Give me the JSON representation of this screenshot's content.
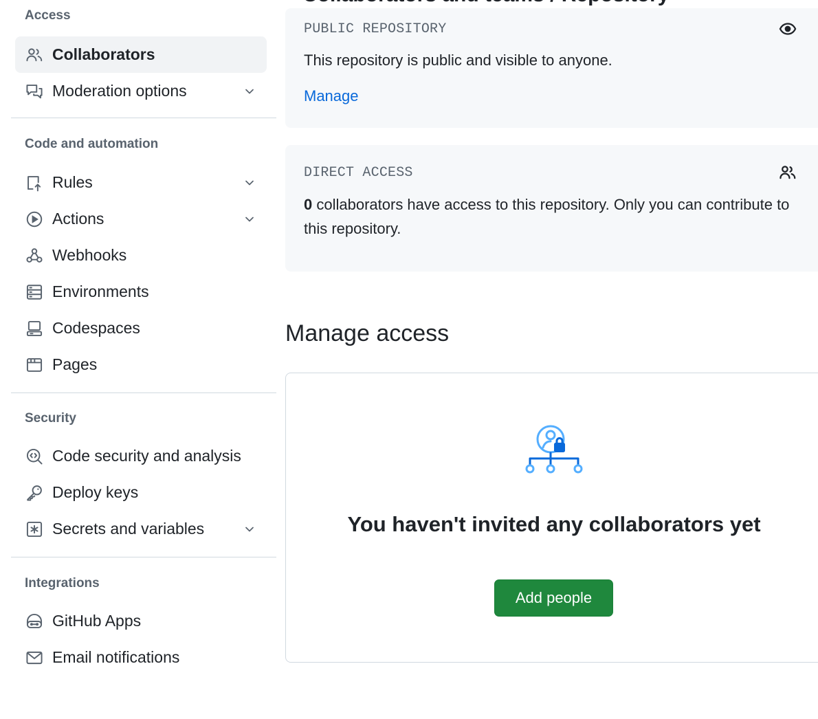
{
  "header": {
    "cut_title": "Collaborators and teams / Repository"
  },
  "sidebar": {
    "sections": [
      {
        "heading": "Access",
        "items": [
          {
            "label": "Collaborators",
            "icon": "people-icon",
            "active": true,
            "expandable": false
          },
          {
            "label": "Moderation options",
            "icon": "comment-discussion-icon",
            "active": false,
            "expandable": true
          }
        ]
      },
      {
        "heading": "Code and automation",
        "items": [
          {
            "label": "Rules",
            "icon": "repo-push-icon",
            "active": false,
            "expandable": true
          },
          {
            "label": "Actions",
            "icon": "play-icon",
            "active": false,
            "expandable": true
          },
          {
            "label": "Webhooks",
            "icon": "webhook-icon",
            "active": false,
            "expandable": false
          },
          {
            "label": "Environments",
            "icon": "server-icon",
            "active": false,
            "expandable": false
          },
          {
            "label": "Codespaces",
            "icon": "codespaces-icon",
            "active": false,
            "expandable": false
          },
          {
            "label": "Pages",
            "icon": "browser-icon",
            "active": false,
            "expandable": false
          }
        ]
      },
      {
        "heading": "Security",
        "items": [
          {
            "label": "Code security and analysis",
            "icon": "codescan-icon",
            "active": false,
            "expandable": false
          },
          {
            "label": "Deploy keys",
            "icon": "key-icon",
            "active": false,
            "expandable": false
          },
          {
            "label": "Secrets and variables",
            "icon": "key-asterisk-icon",
            "active": false,
            "expandable": true
          }
        ]
      },
      {
        "heading": "Integrations",
        "items": [
          {
            "label": "GitHub Apps",
            "icon": "hubot-icon",
            "active": false,
            "expandable": false
          },
          {
            "label": "Email notifications",
            "icon": "mail-icon",
            "active": false,
            "expandable": false
          }
        ]
      }
    ]
  },
  "public_repo": {
    "kicker": "PUBLIC REPOSITORY",
    "text": "This repository is public and visible to anyone.",
    "link": "Manage",
    "icon": "eye-icon"
  },
  "direct_access": {
    "kicker": "DIRECT ACCESS",
    "count": "0",
    "text": " collaborators have access to this repository. Only you can contribute to this repository.",
    "icon": "people-icon"
  },
  "manage_access": {
    "title": "Manage access",
    "empty_title": "You haven't invited any collaborators yet",
    "add_button": "Add people",
    "illustration": "person-lock-network-icon"
  },
  "colors": {
    "accent_link": "#0969da",
    "primary_button": "#1f883d",
    "muted_text": "#59636e",
    "box_background": "#f6f8fa",
    "illustration_blue": "#54aeff",
    "illustration_dark": "#0969da"
  }
}
